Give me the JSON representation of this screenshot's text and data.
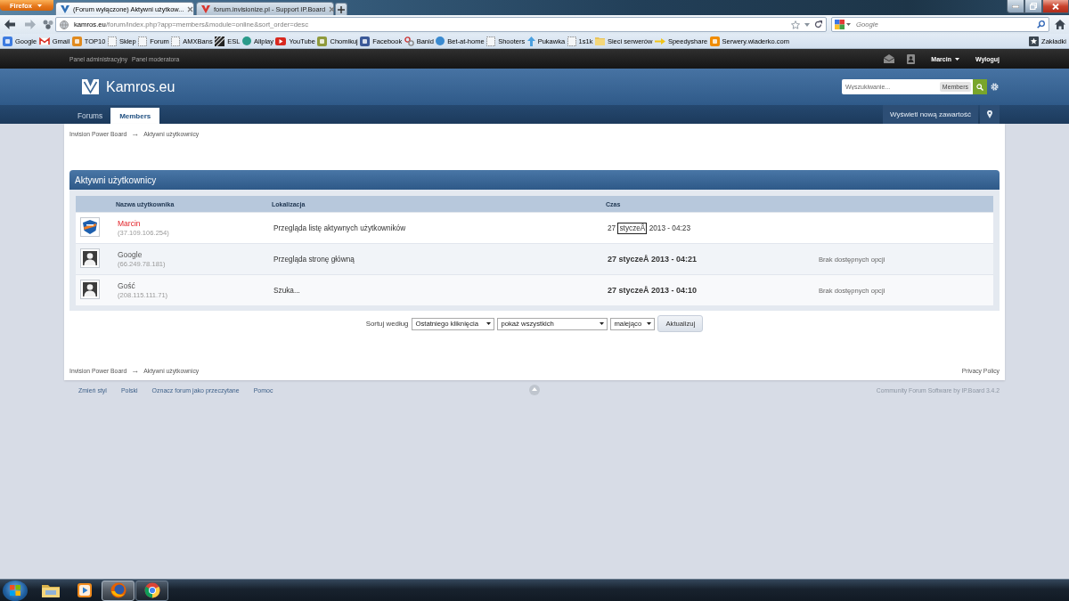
{
  "browser": {
    "menu_button": "Firefox",
    "tabs": [
      {
        "title": "(Forum wyłączone) Aktywni użytkow...",
        "color": "#2f6fb5",
        "selected": true
      },
      {
        "title": "forum.invisionize.pl - Support IP.Board",
        "color": "#d9362f",
        "selected": false
      }
    ],
    "address": {
      "host": "kamros.eu",
      "path": "/forum/index.php?app=members&module=online&sort_order=desc"
    },
    "search": {
      "placeholder": "Google"
    },
    "bookmarks": [
      {
        "label": "Google",
        "kind": "tile",
        "color": "#3d7be0"
      },
      {
        "label": "Gmail",
        "kind": "mail"
      },
      {
        "label": "TOP10",
        "kind": "tile",
        "color": "#e08a1e"
      },
      {
        "label": "Sklep",
        "kind": "blank"
      },
      {
        "label": "Forum",
        "kind": "blank"
      },
      {
        "label": "AMXBans",
        "kind": "blank"
      },
      {
        "label": "ESL",
        "kind": "stripes"
      },
      {
        "label": "Allplay",
        "kind": "dot",
        "color": "#2a9a8a"
      },
      {
        "label": "YouTube",
        "kind": "video"
      },
      {
        "label": "Chomikuj",
        "kind": "tile",
        "color": "#8f9a3c"
      },
      {
        "label": "Facebook",
        "kind": "tile",
        "color": "#3b5998"
      },
      {
        "label": "Banid",
        "kind": "chain"
      },
      {
        "label": "Bet-at-home",
        "kind": "dot",
        "color": "#3a8ad0"
      },
      {
        "label": "Shooters",
        "kind": "blank"
      },
      {
        "label": "Pukawka",
        "kind": "up-arrow",
        "color": "#4aa0e0"
      },
      {
        "label": "1s1k",
        "kind": "blank"
      },
      {
        "label": "Sieci serwerów",
        "kind": "folder"
      },
      {
        "label": "Speedyshare",
        "kind": "arrow",
        "color": "#f0c419"
      },
      {
        "label": "Serwery.wiaderko.com",
        "kind": "tile",
        "color": "#f08c00"
      }
    ],
    "bookmarks_menu": "Zakładki"
  },
  "forum": {
    "user_bar": {
      "links": [
        "Panel administracyjny",
        "Panel moderatora"
      ],
      "user": "Marcin",
      "logout": "Wyloguj"
    },
    "brand": "Kamros.eu",
    "search": {
      "placeholder": "Wyszukiwanie...",
      "scope": "Members"
    },
    "tabs": [
      {
        "label": "Forums",
        "selected": false
      },
      {
        "label": "Members",
        "selected": true
      }
    ],
    "new_content": "Wyświetl nową zawartość",
    "breadcrumb": {
      "items": [
        "Invision Power Board",
        "Aktywni użytkownicy"
      ],
      "separator": "→"
    },
    "online_list": {
      "title": "Aktywni użytkownicy",
      "columns": [
        "Nazwa użytkownika",
        "Lokalizacja",
        "Czas"
      ],
      "rows": [
        {
          "avatar": {
            "kind": "logo"
          },
          "name": "Marcin",
          "highlighted": true,
          "ip": "(37.109.106.254)",
          "location": "Przegląda listę aktywnych użytkowników",
          "time": [
            {
              "text": "27 ",
              "outlined": false
            },
            {
              "text": "styczeÅ",
              "outlined": true
            },
            {
              "text": " 2013 - 04:23",
              "outlined": false
            }
          ],
          "bold_time": false
        },
        {
          "avatar": {
            "kind": "silhouette"
          },
          "name": "Google",
          "highlighted": false,
          "ip": "(66.249.78.181)",
          "location": "Przegląda stronę główną",
          "time": [
            {
              "text": "27 styczeÅ 2013 - 04:21",
              "outlined": false
            }
          ],
          "bold_time": true,
          "options": "Brak dostępnych opcji"
        },
        {
          "avatar": {
            "kind": "silhouette"
          },
          "name": "Gość",
          "highlighted": false,
          "ip": "(208.115.111.71)",
          "location": "Szuka...",
          "time": [
            {
              "text": "27 styczeÅ 2013 - 04:10",
              "outlined": false
            }
          ],
          "bold_time": true,
          "options": "Brak dostępnych opcji"
        }
      ]
    },
    "sort_bar": {
      "label": "Sortuj według",
      "sort_by": "Ostatniego kliknięcia",
      "filter": "pokaż wszystkich",
      "order": "malejąco",
      "button": "Aktualizuj"
    },
    "footer_breadcrumb": {
      "items": [
        "Invision Power Board",
        "Aktywni użytkownicy"
      ],
      "separator": "→"
    },
    "privacy_link": "Privacy Policy",
    "footer_links": [
      "Zmień styl",
      "Polski",
      "Oznacz forum jako przeczytane",
      "Pomoc"
    ],
    "copyright": "Community Forum Software by IP.Board 3.4.2"
  },
  "taskbar": {
    "apps": [
      {
        "kind": "folder",
        "running": false,
        "selected": false
      },
      {
        "kind": "player",
        "running": false,
        "selected": false
      },
      {
        "kind": "firefox",
        "running": true,
        "selected": true
      },
      {
        "kind": "chrome",
        "running": true,
        "selected": false
      }
    ]
  }
}
